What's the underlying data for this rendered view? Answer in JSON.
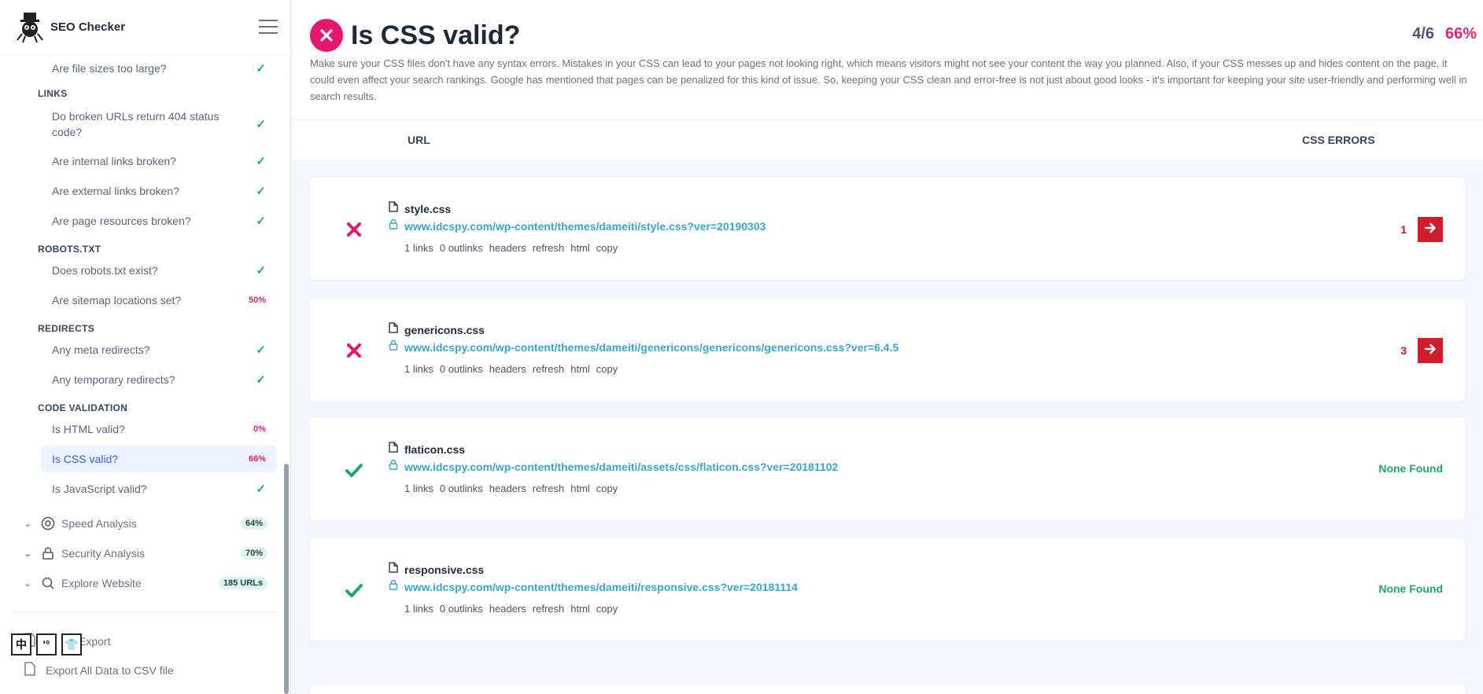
{
  "brand": {
    "title": "SEO Checker"
  },
  "sidebar": {
    "items": [
      {
        "label": "Are file sizes too large?",
        "status": "ok"
      },
      {
        "section": "LINKS"
      },
      {
        "label": "Do broken URLs return 404 status code?",
        "status": "ok"
      },
      {
        "label": "Are internal links broken?",
        "status": "ok"
      },
      {
        "label": "Are external links broken?",
        "status": "ok"
      },
      {
        "label": "Are page resources broken?",
        "status": "ok"
      },
      {
        "section": "ROBOTS.TXT"
      },
      {
        "label": "Does robots.txt exist?",
        "status": "ok"
      },
      {
        "label": "Are sitemap locations set?",
        "pct": "50%"
      },
      {
        "section": "REDIRECTS"
      },
      {
        "label": "Any meta redirects?",
        "status": "ok"
      },
      {
        "label": "Any temporary redirects?",
        "status": "ok"
      },
      {
        "section": "CODE VALIDATION"
      },
      {
        "label": "Is HTML valid?",
        "pct": "0%"
      },
      {
        "label": "Is CSS valid?",
        "pct": "66%",
        "active": true
      },
      {
        "label": "Is JavaScript valid?",
        "status": "ok"
      }
    ],
    "groups": [
      {
        "label": "Speed Analysis",
        "badge": "64%",
        "icon": "speed-icon"
      },
      {
        "label": "Security Analysis",
        "badge": "70%",
        "icon": "lock-icon"
      },
      {
        "label": "Explore Website",
        "badge": "185 URLs",
        "icon": "search-icon"
      }
    ],
    "exports": [
      {
        "label": "Export"
      },
      {
        "label": "Export All Data to CSV file"
      }
    ],
    "ime": [
      "中",
      "'°",
      "👕"
    ]
  },
  "header": {
    "title": "Is CSS valid?",
    "score_fraction": "4/6",
    "score_percent": "66%",
    "description": "Make sure your CSS files don't have any syntax errors. Mistakes in your CSS can lead to your pages not looking right, which means visitors might not see your content the way you planned. Also, if your CSS messes up and hides content on the page, it could even affect your search rankings. Google has mentioned that pages can be penalized for this kind of issue. So, keeping your CSS clean and error-free is not just about good looks - it's important for keeping your site user-friendly and performing well in search results."
  },
  "table": {
    "col_url": "URL",
    "col_errors": "CSS ERRORS",
    "action_labels": [
      "1 links",
      "0 outlinks",
      "headers",
      "refresh",
      "html",
      "copy"
    ],
    "rows": [
      {
        "file": "style.css",
        "url": "www.idcspy.com/wp-content/themes/dameiti/style.css?ver=20190303",
        "status": "fail",
        "errors": "1"
      },
      {
        "file": "genericons.css",
        "url": "www.idcspy.com/wp-content/themes/dameiti/genericons/genericons/genericons.css?ver=6.4.5",
        "status": "fail",
        "errors": "3"
      },
      {
        "file": "flaticon.css",
        "url": "www.idcspy.com/wp-content/themes/dameiti/assets/css/flaticon.css?ver=20181102",
        "status": "pass",
        "errors": "None Found"
      },
      {
        "file": "responsive.css",
        "url": "www.idcspy.com/wp-content/themes/dameiti/responsive.css?ver=20181114",
        "status": "pass",
        "errors": "None Found"
      }
    ]
  },
  "colors": {
    "fail": "#e6176f",
    "pass": "#1ea57a",
    "link": "#3aa6c9",
    "error_button": "#d11e2c",
    "percent": "#e0237a"
  }
}
